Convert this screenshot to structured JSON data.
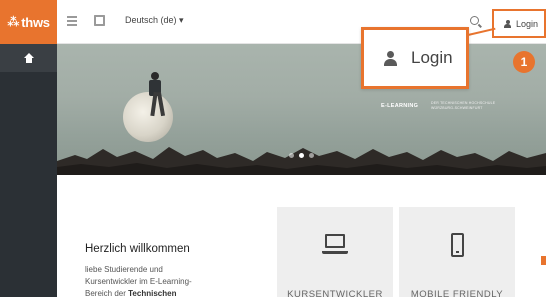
{
  "header": {
    "logo_text": "thws",
    "language": "Deutsch (de) ▾",
    "login_label": "Login"
  },
  "callout": {
    "login_label": "Login",
    "step_number": "1"
  },
  "hero": {
    "brand": "E-LEARNING",
    "brand_sub_1": "DER TECHNISCHEN HOCHSCHULE",
    "brand_sub_2": "WÜRZBURG-SCHWEINFURT",
    "slide_count": 3,
    "active_slide": 2
  },
  "content": {
    "welcome_title": "Herzlich willkommen",
    "welcome_line_1": "liebe Studierende und",
    "welcome_line_2": "Kursentwickler im E-Learning-",
    "welcome_line_3_prefix": "Bereich der ",
    "welcome_line_3_bold": "Technischen"
  },
  "cards": [
    {
      "label": "KURSENTWICKLER",
      "icon": "laptop-icon"
    },
    {
      "label": "MOBILE FRIENDLY",
      "icon": "mobile-icon"
    }
  ],
  "colors": {
    "brand_orange": "#e8742e",
    "sidebar_dark": "#2b3035"
  }
}
